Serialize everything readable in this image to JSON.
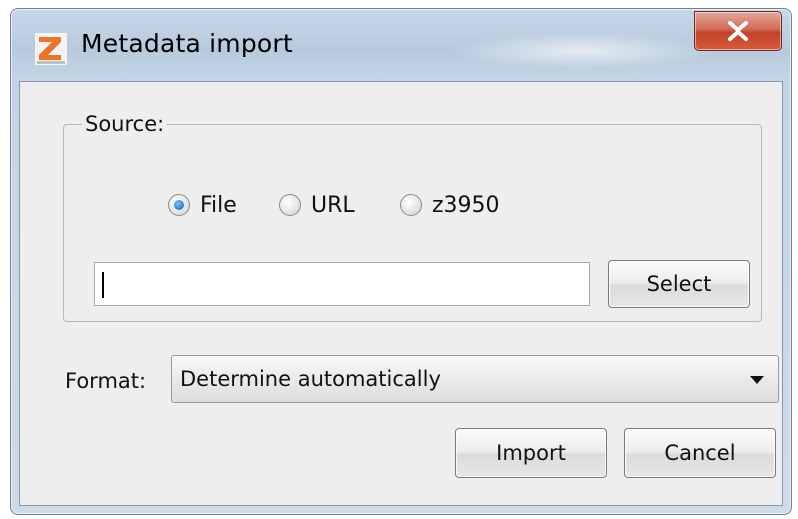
{
  "window": {
    "title": "Metadata import",
    "app_icon": "zotero-like-z-icon",
    "close_icon": "close-x-icon"
  },
  "source": {
    "legend": "Source:",
    "options": [
      {
        "label": "File",
        "checked": true
      },
      {
        "label": "URL",
        "checked": false
      },
      {
        "label": "z3950",
        "checked": false
      }
    ],
    "path_value": "",
    "select_label": "Select"
  },
  "format": {
    "label": "Format:",
    "selected": "Determine automatically"
  },
  "actions": {
    "import_label": "Import",
    "cancel_label": "Cancel"
  },
  "colors": {
    "title_bar": "#c3d4e4",
    "close_button": "#c1412a",
    "dialog_body": "#eeeeee",
    "radio_selected": "#2a7fc8"
  }
}
